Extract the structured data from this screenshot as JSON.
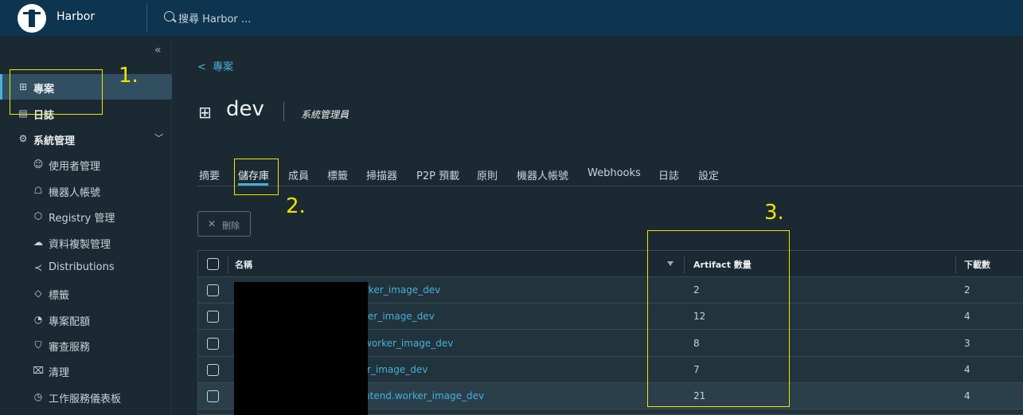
{
  "topbar": {
    "brand": "Harbor",
    "search_placeholder": "搜尋 Harbor ..."
  },
  "sidebar": {
    "collapse_icon": "double-chevron-left-icon",
    "items": [
      {
        "label": "專案",
        "icon": "project-icon",
        "active": true
      },
      {
        "label": "日誌",
        "icon": "log-icon"
      },
      {
        "label": "系統管理",
        "icon": "admin-icon",
        "expanded": true
      }
    ],
    "sub_items": [
      {
        "label": "使用者管理",
        "icon": "users-icon"
      },
      {
        "label": "機器人帳號",
        "icon": "robot-icon"
      },
      {
        "label": "Registry 管理",
        "icon": "cube-icon"
      },
      {
        "label": "資料複製管理",
        "icon": "cloud-icon"
      },
      {
        "label": "Distributions",
        "icon": "share-icon"
      },
      {
        "label": "標籤",
        "icon": "tag-icon"
      },
      {
        "label": "專案配額",
        "icon": "gauge-icon"
      },
      {
        "label": "審查服務",
        "icon": "shield-icon"
      },
      {
        "label": "清理",
        "icon": "trash-icon"
      },
      {
        "label": "工作服務儀表板",
        "icon": "dashboard-icon"
      }
    ]
  },
  "annotations": {
    "n1": "1.",
    "n2": "2.",
    "n3": "3."
  },
  "project": {
    "back_label": "專案",
    "name": "dev",
    "role": "系統管理員"
  },
  "tabs": [
    "摘要",
    "儲存庫",
    "成員",
    "標籤",
    "掃描器",
    "P2P 預載",
    "原則",
    "機器人帳號",
    "Webhooks",
    "日誌",
    "設定"
  ],
  "active_tab": "儲存庫",
  "toolbar": {
    "delete_label": "刪除"
  },
  "table": {
    "headers": {
      "name": "名稱",
      "artifacts": "Artifact 數量",
      "downloads": "下載數"
    },
    "rows": [
      {
        "name": "rker_image_dev",
        "artifacts": "2",
        "downloads": "2"
      },
      {
        "name": "er_image_dev",
        "artifacts": "12",
        "downloads": "4"
      },
      {
        "name": "worker_image_dev",
        "artifacts": "8",
        "downloads": "3"
      },
      {
        "name": "r_image_dev",
        "artifacts": "7",
        "downloads": "4"
      },
      {
        "name": "ntend.worker_image_dev",
        "artifacts": "21",
        "downloads": "4"
      }
    ]
  },
  "colors": {
    "accent": "#49afd9",
    "topbar": "#0e3550",
    "annotation": "#f0e600"
  }
}
